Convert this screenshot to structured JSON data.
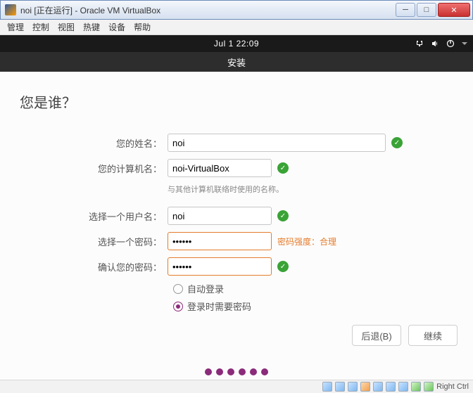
{
  "window": {
    "title": "noi [正在运行] - Oracle VM VirtualBox",
    "menu": [
      "管理",
      "控制",
      "视图",
      "热键",
      "设备",
      "帮助"
    ]
  },
  "vm_topbar": {
    "time": "Jul 1  22:09"
  },
  "installer": {
    "header": "安装",
    "title": "您是谁？",
    "labels": {
      "name": "您的姓名：",
      "computer": "您的计算机名：",
      "computer_hint": "与其他计算机联络时使用的名称。",
      "username": "选择一个用户名：",
      "password": "选择一个密码：",
      "pw_strength": "密码强度：合理",
      "confirm": "确认您的密码：",
      "auto_login": "自动登录",
      "require_pw": "登录时需要密码"
    },
    "values": {
      "name": "noi",
      "computer": "noi-VirtualBox",
      "username": "noi",
      "password": "••••••",
      "confirm": "••••••"
    },
    "buttons": {
      "back": "后退(B)",
      "continue": "继续"
    }
  },
  "status": {
    "hostkey": "Right Ctrl"
  }
}
